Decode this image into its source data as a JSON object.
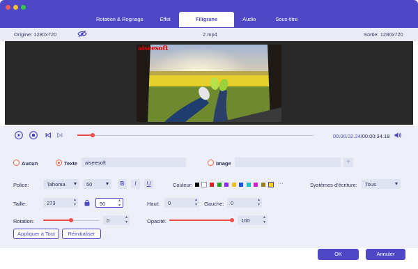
{
  "window": {
    "controls": [
      "close",
      "minimize",
      "zoom"
    ],
    "colors": {
      "close": "#ee5f57",
      "minimize": "#f6bd2e",
      "zoom": "#35c748"
    }
  },
  "tabs": [
    {
      "label": "Rotation & Rognage",
      "active": false
    },
    {
      "label": "Effet",
      "active": false
    },
    {
      "label": "Filigrane",
      "active": true
    },
    {
      "label": "Audio",
      "active": false
    },
    {
      "label": "Sous-titre",
      "active": false
    }
  ],
  "info": {
    "origin": "Origine: 1280x720",
    "file": "2.mp4",
    "output": "Sortie: 1280x720",
    "eye_icon": "eye-icon"
  },
  "preview": {
    "watermark_text": "aiseesoft"
  },
  "player": {
    "current_time": "00:00:02.24",
    "total_time": "/00:00:34.18",
    "progress": 0.066
  },
  "watermark": {
    "none_label": "Aucun",
    "text_label": "Texte",
    "text_value": "aiseesoft",
    "image_label": "Image",
    "image_value": "",
    "selected": "Texte"
  },
  "font": {
    "font_label": "Police:",
    "font_value": "Tahoma",
    "size_value": "50",
    "bold": "B",
    "italic": "I",
    "underline": "U",
    "color_label": "Couleur:",
    "colors": [
      "#000000",
      "#ffffff",
      "#e02020",
      "#20a020",
      "#8a2be2",
      "#f0c010",
      "#1e50e6",
      "#20c0c0",
      "#d020d0",
      "#9a7d1b",
      "#ffd400"
    ],
    "more": "···",
    "writing_label": "Systèmes d'écriture:",
    "writing_value": "Tous"
  },
  "size": {
    "label": "Taille:",
    "width": "273",
    "height": "90",
    "top_label": "Haut:",
    "top_value": "0",
    "left_label": "Gauche:",
    "left_value": "0"
  },
  "rotation": {
    "label": "Rotation:",
    "value": "0",
    "level": 0.5
  },
  "opacity": {
    "label": "Opacité:",
    "value": "100",
    "level": 1.0
  },
  "buttons": {
    "apply_all": "Appliquer à Tout",
    "reset": "Réinitialiser",
    "ok": "OK",
    "cancel": "Annuler"
  }
}
